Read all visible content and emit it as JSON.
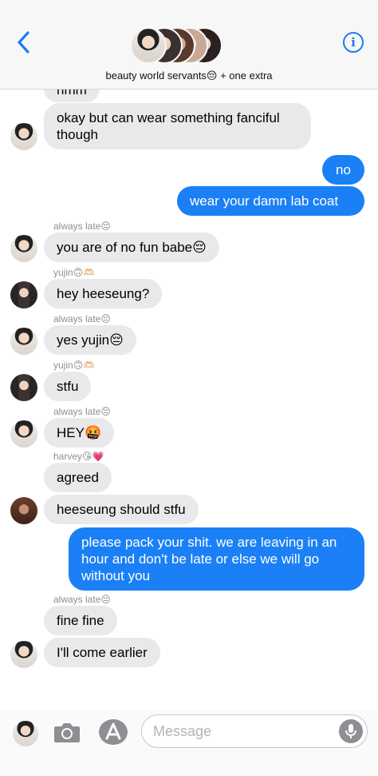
{
  "header": {
    "group_name": "beauty world servants😔 + one extra",
    "back_icon": "chevron-left-icon",
    "info_icon": "info-icon",
    "info_glyph": "i",
    "accent": "#1e7cf2"
  },
  "messages": [
    {
      "dir": "in",
      "text": "hmm"
    },
    {
      "dir": "in",
      "text": "okay but can wear something fanciful though"
    },
    {
      "dir": "out",
      "text": "no"
    },
    {
      "dir": "out",
      "text": "wear your damn lab coat"
    },
    {
      "dir": "in",
      "sender": "always late😔",
      "text": "you are of no fun babe😔"
    },
    {
      "dir": "in",
      "sender": "yujin🙃🫶🏻",
      "text": "hey heeseung?"
    },
    {
      "dir": "in",
      "sender": "always late😔",
      "text": "yes yujin😔"
    },
    {
      "dir": "in",
      "sender": "yujin🙃🫶🏻",
      "text": "stfu"
    },
    {
      "dir": "in",
      "sender": "always late😔",
      "text": "HEY🤬"
    },
    {
      "dir": "in",
      "sender": "harvey😘💗",
      "text": "agreed"
    },
    {
      "dir": "in",
      "text": "heeseung should stfu"
    },
    {
      "dir": "out",
      "text": "please pack your shit. we are leaving in an hour and don't be late or else we will go without you"
    },
    {
      "dir": "in",
      "sender": "always late😔",
      "text": "fine fine"
    },
    {
      "dir": "in",
      "text": "I'll come earlier"
    }
  ],
  "composer": {
    "placeholder": "Message",
    "camera_icon": "camera-icon",
    "appstore_icon": "app-store-icon",
    "mic_icon": "microphone-icon"
  },
  "colors": {
    "incoming_bubble": "#e9e9eb",
    "outgoing_bubble": "#1b80f5"
  }
}
